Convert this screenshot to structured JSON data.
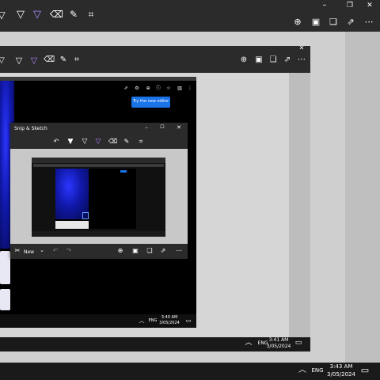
{
  "outer": {
    "toolbar_icons_left": [
      "pen-icon",
      "highlighter-icon",
      "eraser-icon",
      "ruler-icon",
      "crop-icon"
    ],
    "toolbar_icons_right": [
      "zoom-icon",
      "save-icon",
      "copy-icon",
      "share-icon",
      "more-icon"
    ],
    "window_controls": {
      "min": "–",
      "max": "❐",
      "close": "✕"
    },
    "taskbar": {
      "lang": "ENG",
      "time": "3:43 AM",
      "date": "3/05/2024"
    }
  },
  "level2": {
    "taskbar": {
      "lang": "ENG",
      "time": "3:41 AM",
      "date": "3/05/2024"
    }
  },
  "level3": {
    "try_editor_label": "Try the new editor",
    "taskbar": {
      "lang": "ENG",
      "time": "3:40 AM",
      "date": "3/05/2024"
    }
  },
  "snip_window": {
    "title": "Snip & Sketch",
    "new_label": "New"
  },
  "colors": {
    "accent": "#1a73e8",
    "purple": "#b388ff",
    "toolbar": "#2b2b2b"
  }
}
